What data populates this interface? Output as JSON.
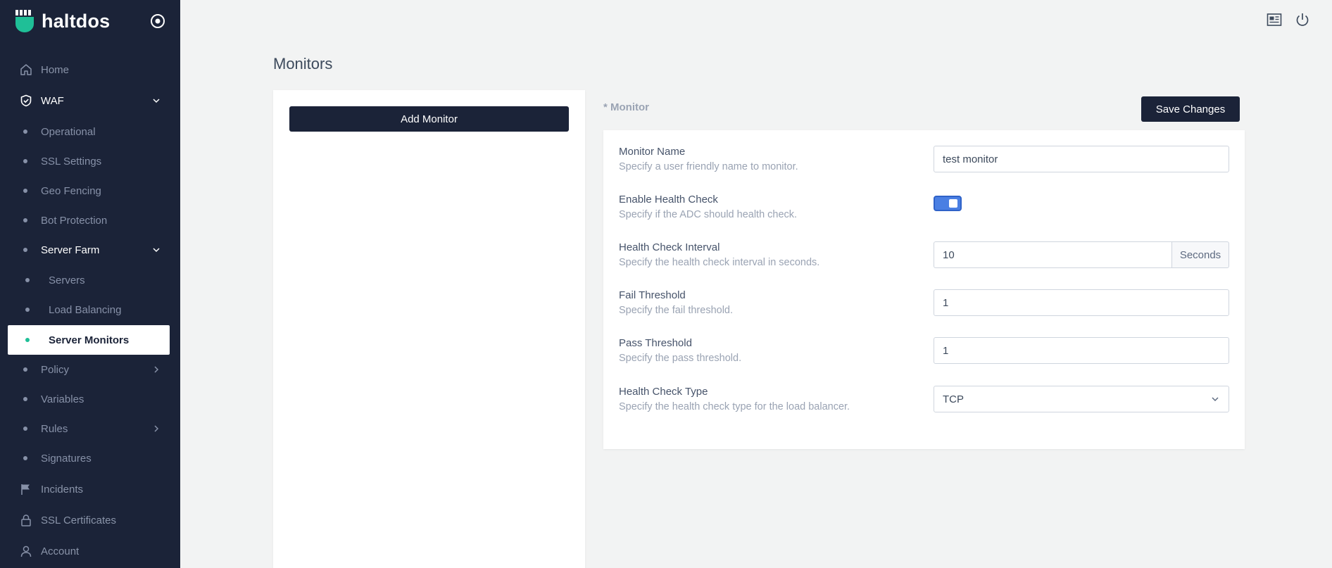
{
  "brand": {
    "name": "haltdos"
  },
  "sidebar": {
    "items": [
      {
        "label": "Home"
      },
      {
        "label": "WAF"
      },
      {
        "label": "Operational"
      },
      {
        "label": "SSL Settings"
      },
      {
        "label": "Geo Fencing"
      },
      {
        "label": "Bot Protection"
      },
      {
        "label": "Server Farm"
      },
      {
        "label": "Servers"
      },
      {
        "label": "Load Balancing"
      },
      {
        "label": "Server Monitors"
      },
      {
        "label": "Policy"
      },
      {
        "label": "Variables"
      },
      {
        "label": "Rules"
      },
      {
        "label": "Signatures"
      },
      {
        "label": "Incidents"
      },
      {
        "label": "SSL Certificates"
      },
      {
        "label": "Account"
      }
    ]
  },
  "page": {
    "title": "Monitors"
  },
  "left_panel": {
    "add_button": "Add Monitor"
  },
  "form": {
    "section_label": "* Monitor",
    "save_button": "Save Changes",
    "fields": [
      {
        "label": "Monitor Name",
        "help": "Specify a user friendly name to monitor.",
        "value": "test monitor"
      },
      {
        "label": "Enable Health Check",
        "help": "Specify if the ADC should health check.",
        "checked": true
      },
      {
        "label": "Health Check Interval",
        "help": "Specify the health check interval in seconds.",
        "value": "10",
        "addon": "Seconds"
      },
      {
        "label": "Fail Threshold",
        "help": "Specify the fail threshold.",
        "value": "1"
      },
      {
        "label": "Pass Threshold",
        "help": "Specify the pass threshold.",
        "value": "1"
      },
      {
        "label": "Health Check Type",
        "help": "Specify the health check type for the load balancer.",
        "value": "TCP"
      }
    ]
  },
  "colors": {
    "sidebar_bg": "#1b2338",
    "accent": "#1fbf97",
    "toggle_on": "#4a7fe3"
  }
}
